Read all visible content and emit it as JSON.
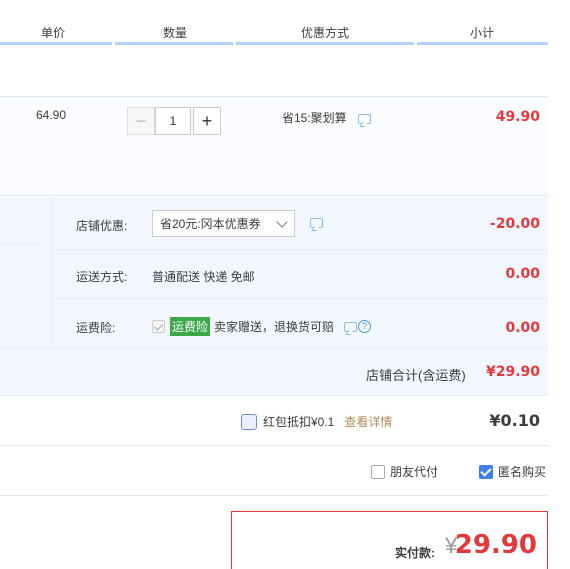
{
  "header": {
    "col_price": "单价",
    "col_qty": "数量",
    "col_promo": "优惠方式",
    "col_subtotal": "小计"
  },
  "item": {
    "price": "64.90",
    "qty_minus": "−",
    "quantity": "1",
    "qty_plus": "+",
    "promo_text": "省15:聚划算",
    "subtotal": "49.90"
  },
  "shop": {
    "discount_label": "店铺优惠:",
    "discount_select": "省20元:冈本优惠券",
    "discount_value": "-20.00",
    "shipping_label": "运送方式:",
    "shipping_text": "普通配送 快递 免邮",
    "shipping_value": "0.00",
    "insurance_label": "运费险:",
    "insurance_badge": "运费险",
    "insurance_text": "卖家赠送，退换货可赔",
    "insurance_value": "0.00",
    "total_label": "店铺合计(含运费)",
    "total_value": "¥29.90"
  },
  "red_packet": {
    "label": "红包抵扣¥0.1",
    "link": "查看详情",
    "value": "¥0.10"
  },
  "options": {
    "friend_pay": "朋友代付",
    "anonymous": "匿名购买",
    "anonymous_checked": true,
    "friend_pay_checked": false
  },
  "payment": {
    "label": "实付款:",
    "currency": "¥",
    "value": "29.90"
  },
  "colors": {
    "accent_red": "#e4393c",
    "header_line": "#b2d1ff",
    "shop_bg": "#f2f7ff",
    "badge_green": "#3ba84a",
    "checkbox_blue": "#3d7ff0"
  }
}
